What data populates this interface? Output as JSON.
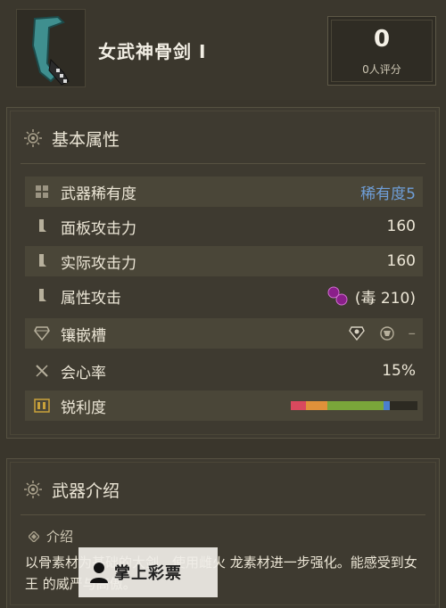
{
  "header": {
    "weapon_name": "女武神骨剑 I",
    "rating_value": "0",
    "rating_label": "0人评分",
    "weapon_icon": "great-sword-icon"
  },
  "attributes": {
    "title": "基本属性",
    "title_icon": "sun-emblem-icon",
    "rows": [
      {
        "label": "武器稀有度",
        "value": "稀有度5",
        "icon": "rarity-grid-icon"
      },
      {
        "label": "面板攻击力",
        "value": "160",
        "icon": "blade-icon"
      },
      {
        "label": "实际攻击力",
        "value": "160",
        "icon": "blade-icon"
      },
      {
        "label": "属性攻击",
        "value": "(毒 210)",
        "icon": "blade-icon"
      },
      {
        "label": "镶嵌槽",
        "value": "–",
        "icon": "gem-icon"
      },
      {
        "label": "会心率",
        "value": "15%",
        "icon": "crossed-swords-icon"
      },
      {
        "label": "锐利度",
        "value": "",
        "icon": "sharpness-icon"
      }
    ],
    "sharpness": [
      {
        "color": "#d9495e",
        "fraction": 0.12
      },
      {
        "color": "#e0913a",
        "fraction": 0.17
      },
      {
        "color": "#c8b23a",
        "fraction": 0.0
      },
      {
        "color": "#7aa63a",
        "fraction": 0.44
      },
      {
        "color": "#4a7fd0",
        "fraction": 0.05
      },
      {
        "color": "#2c2a22",
        "fraction": 0.22
      }
    ],
    "accent_color": "#6f9fd9",
    "poison_color": "#8a1f8a"
  },
  "intro": {
    "title": "武器介绍",
    "subtitle": "介绍",
    "text": "以骨素材为基础的大剑。使用雌火 龙素材进一步强化。能感受到女王 的威严与高傲。"
  },
  "watermark": {
    "text": "掌上彩票"
  }
}
